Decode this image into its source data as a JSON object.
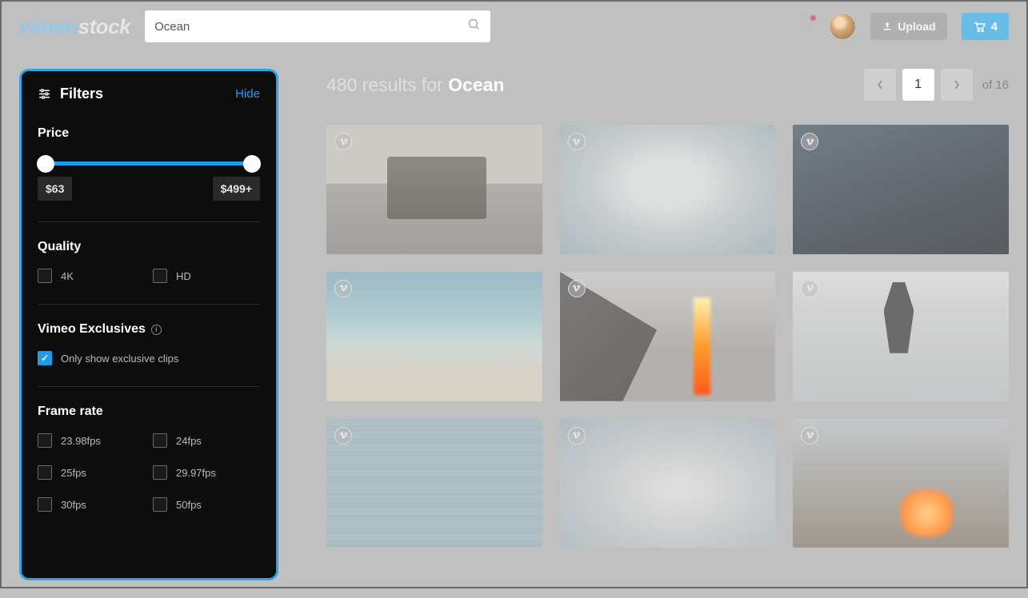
{
  "brand": {
    "vimeo": "vimeo",
    "stock": "stock"
  },
  "search": {
    "value": "Ocean",
    "placeholder": ""
  },
  "header": {
    "upload": "Upload",
    "cart_count": "4"
  },
  "filters": {
    "title": "Filters",
    "hide": "Hide",
    "price": {
      "title": "Price",
      "min": "$63",
      "max": "$499+"
    },
    "quality": {
      "title": "Quality",
      "items": [
        "4K",
        "HD"
      ]
    },
    "exclusives": {
      "title": "Vimeo Exclusives",
      "option": "Only show exclusive clips",
      "checked": true
    },
    "framerate": {
      "title": "Frame rate",
      "items": [
        "23.98fps",
        "24fps",
        "25fps",
        "29.97fps",
        "30fps",
        "50fps"
      ]
    }
  },
  "results": {
    "count_prefix": "480 results for ",
    "term": "Ocean",
    "page_current": "1",
    "page_total": "of 16"
  }
}
